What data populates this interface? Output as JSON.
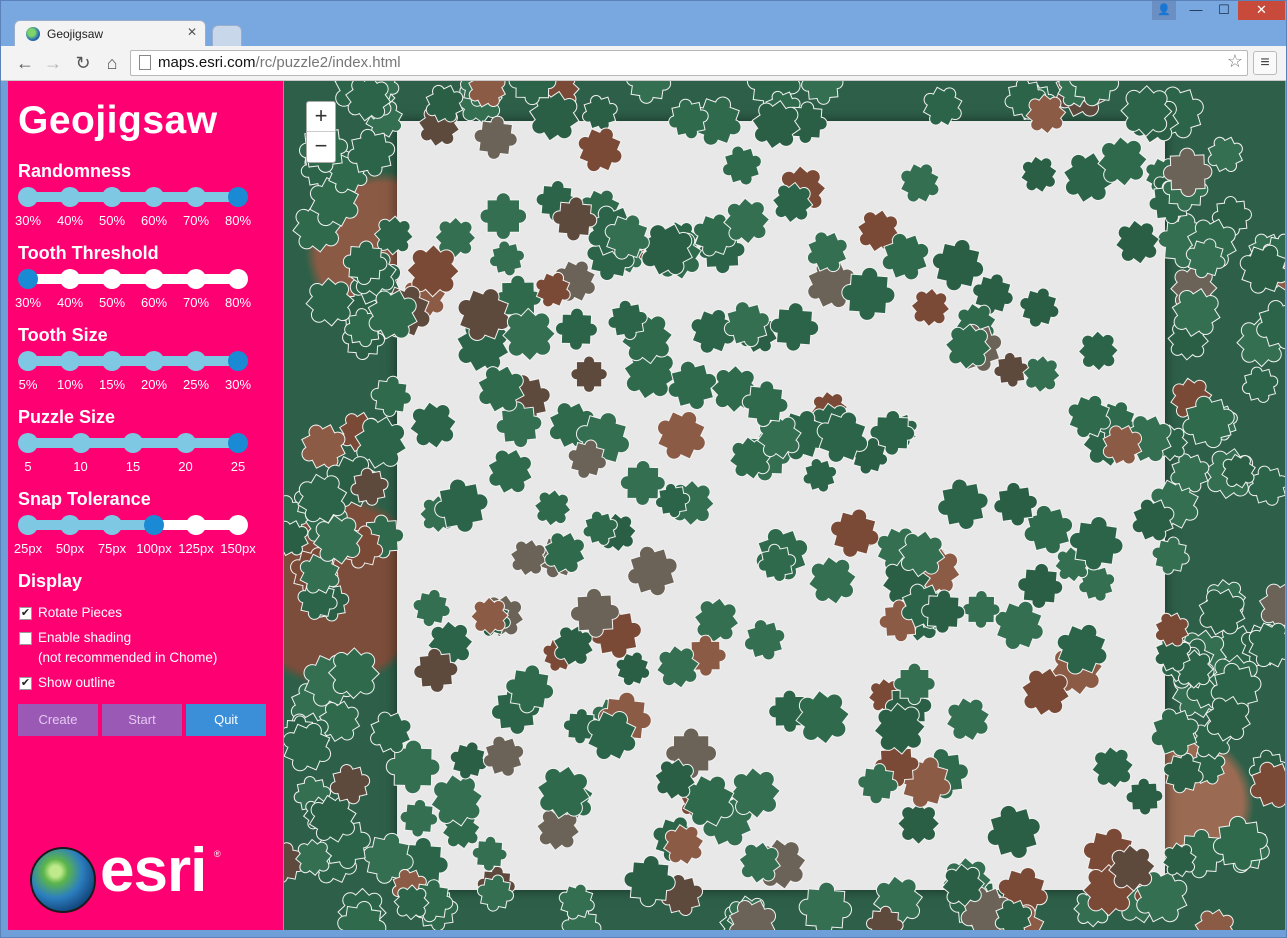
{
  "browser": {
    "tab_title": "Geojigsaw",
    "url_host": "maps.esri.com",
    "url_path": "/rc/puzzle2/index.html"
  },
  "sidebar": {
    "title": "Geojigsaw",
    "sliders": [
      {
        "label": "Randomness",
        "ticks": [
          "30%",
          "40%",
          "50%",
          "60%",
          "70%",
          "80%"
        ],
        "selected_index": 5
      },
      {
        "label": "Tooth Threshold",
        "ticks": [
          "30%",
          "40%",
          "50%",
          "60%",
          "70%",
          "80%"
        ],
        "selected_index": 0
      },
      {
        "label": "Tooth Size",
        "ticks": [
          "5%",
          "10%",
          "15%",
          "20%",
          "25%",
          "30%"
        ],
        "selected_index": 5
      },
      {
        "label": "Puzzle Size",
        "ticks": [
          "5",
          "10",
          "15",
          "20",
          "25"
        ],
        "selected_index": 4
      },
      {
        "label": "Snap Tolerance",
        "ticks": [
          "25px",
          "50px",
          "75px",
          "100px",
          "125px",
          "150px"
        ],
        "selected_index": 3
      }
    ],
    "display": {
      "title": "Display",
      "options": [
        {
          "label": "Rotate Pieces",
          "checked": true
        },
        {
          "label": "Enable shading",
          "sublabel": "(not recommended in Chome)",
          "checked": false
        },
        {
          "label": "Show outline",
          "checked": true
        }
      ]
    },
    "buttons": {
      "create": "Create",
      "start": "Start",
      "quit": "Quit"
    },
    "logo_text": "esri"
  },
  "map": {
    "zoom_in": "+",
    "zoom_out": "−"
  },
  "colors": {
    "sidebar": "#ff0073",
    "slider_active": "#7ec8e3",
    "knob_selected": "#1a8ad4",
    "piece_green": "#2f6a4c",
    "board": "#e8e8e8"
  }
}
